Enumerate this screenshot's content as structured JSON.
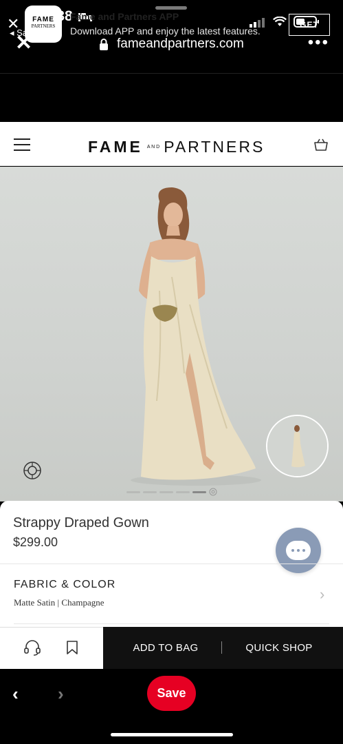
{
  "status_bar": {
    "time": "10:38",
    "back_app": "◂ Safari"
  },
  "browser": {
    "url": "fameandpartners.com"
  },
  "app_banner": {
    "title": "Fame and Partners APP",
    "subtitle": "Download APP and enjoy the latest features.",
    "logo_line1": "FAME",
    "logo_line2": "PARTNERS",
    "get_label": "GET"
  },
  "site_header": {
    "brand_left": "FAME",
    "brand_and": "A N D",
    "brand_right": "PARTNERS"
  },
  "product": {
    "name": "Strappy Draped Gown",
    "price": "$299.00",
    "fabric_color_label": "FABRIC & COLOR",
    "fabric_color_value": "Matte Satin | Champagne"
  },
  "action_bar": {
    "add_to_bag": "ADD TO BAG",
    "separator": "|",
    "quick_shop": "QUICK SHOP"
  },
  "bottom_bar": {
    "save_label": "Save"
  },
  "colors": {
    "save_red": "#e60023",
    "chat_blue": "#8a9bb6",
    "gown_champagne": "#e9dfc4"
  }
}
